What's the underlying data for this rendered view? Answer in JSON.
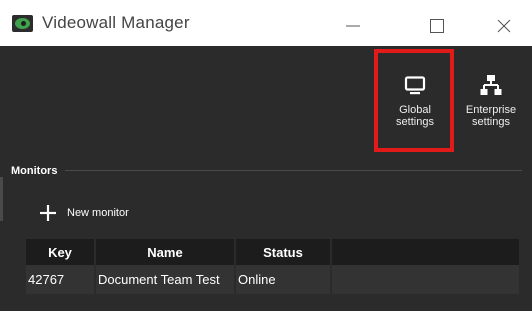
{
  "window": {
    "title": "Videowall Manager",
    "controls": [
      "minimize",
      "maximize",
      "close"
    ]
  },
  "toolbar": {
    "global_settings": {
      "line1": "Global",
      "line2": "settings",
      "icon": "monitor-icon"
    },
    "enterprise_settings": {
      "line1": "Enterprise",
      "line2": "settings",
      "icon": "network-icon"
    }
  },
  "monitors": {
    "section_title": "Monitors",
    "new_monitor_label": "New monitor",
    "columns": [
      "Key",
      "Name",
      "Status",
      ""
    ],
    "rows": [
      {
        "key": "42767",
        "name": "Document Team Test",
        "status": "Online"
      }
    ]
  },
  "annotation": {
    "highlight_color": "#e11a1a",
    "target": "global-settings-button"
  },
  "colors": {
    "background": "#2b2b2b",
    "header": "#1c1c1c",
    "row": "#333333",
    "brand": "#3fa34d"
  }
}
